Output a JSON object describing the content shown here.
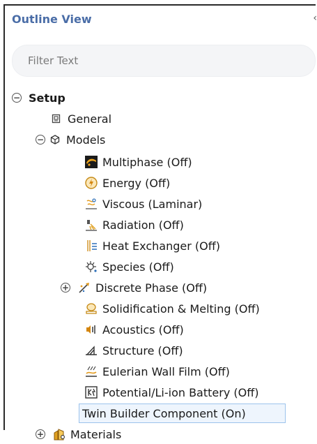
{
  "panel": {
    "title": "Outline View",
    "filter_placeholder": "Filter Text",
    "collapse_glyph": "‹"
  },
  "tree": {
    "setup": {
      "label": "Setup",
      "toggle": "−"
    },
    "general": {
      "label": "General",
      "icon": "general-icon"
    },
    "models": {
      "label": "Models",
      "toggle": "−",
      "icon": "models-icon"
    },
    "items": [
      {
        "label": "Multiphase (Off)",
        "icon": "multiphase-icon"
      },
      {
        "label": "Energy (Off)",
        "icon": "energy-icon"
      },
      {
        "label": "Viscous (Laminar)",
        "icon": "viscous-icon"
      },
      {
        "label": "Radiation (Off)",
        "icon": "radiation-icon"
      },
      {
        "label": "Heat Exchanger (Off)",
        "icon": "heat-exchanger-icon"
      },
      {
        "label": "Species (Off)",
        "icon": "species-icon"
      },
      {
        "label": "Discrete Phase (Off)",
        "icon": "discrete-phase-icon",
        "toggle": "+"
      },
      {
        "label": "Solidification & Melting (Off)",
        "icon": "solidification-icon"
      },
      {
        "label": "Acoustics (Off)",
        "icon": "acoustics-icon"
      },
      {
        "label": "Structure (Off)",
        "icon": "structure-icon"
      },
      {
        "label": "Eulerian Wall Film (Off)",
        "icon": "eulerian-wall-film-icon"
      },
      {
        "label": "Potential/Li-ion Battery (Off)",
        "icon": "battery-icon"
      },
      {
        "label": "Twin Builder Component (On)",
        "icon": "",
        "selected": true
      }
    ],
    "materials": {
      "label": "Materials",
      "toggle": "+",
      "icon": "materials-icon"
    }
  },
  "colors": {
    "title": "#4a6da7",
    "selection_bg": "#eef5fd",
    "selection_border": "#9cc3ec"
  }
}
